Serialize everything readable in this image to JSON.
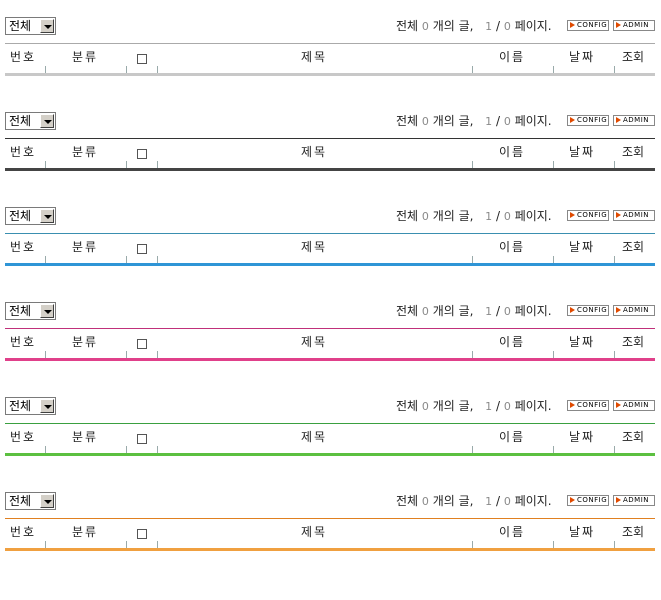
{
  "boards": [
    {
      "filter": "전체",
      "status": {
        "pre": "전체",
        "count": "0",
        "mid": "개의 글,",
        "page": "1",
        "sep": "/",
        "total": "0",
        "suf": "페이지."
      },
      "buttons": {
        "config": "CONFIG",
        "admin": "ADMIN"
      },
      "columns": {
        "num": "번호",
        "category": "분류",
        "title": "제목",
        "name": "이름",
        "date": "날짜",
        "views": "조회"
      },
      "colors": {
        "top": "#aaaaaa",
        "bottom": "#c8c8c8"
      }
    },
    {
      "filter": "전체",
      "status": {
        "pre": "전체",
        "count": "0",
        "mid": "개의 글,",
        "page": "1",
        "sep": "/",
        "total": "0",
        "suf": "페이지."
      },
      "buttons": {
        "config": "CONFIG",
        "admin": "ADMIN"
      },
      "columns": {
        "num": "번호",
        "category": "분류",
        "title": "제목",
        "name": "이름",
        "date": "날짜",
        "views": "조회"
      },
      "colors": {
        "top": "#333333",
        "bottom": "#444444"
      }
    },
    {
      "filter": "전체",
      "status": {
        "pre": "전체",
        "count": "0",
        "mid": "개의 글,",
        "page": "1",
        "sep": "/",
        "total": "0",
        "suf": "페이지."
      },
      "buttons": {
        "config": "CONFIG",
        "admin": "ADMIN"
      },
      "columns": {
        "num": "번호",
        "category": "분류",
        "title": "제목",
        "name": "이름",
        "date": "날짜",
        "views": "조회"
      },
      "colors": {
        "top": "#3a8fb0",
        "bottom": "#2f95d6"
      }
    },
    {
      "filter": "전체",
      "status": {
        "pre": "전체",
        "count": "0",
        "mid": "개의 글,",
        "page": "1",
        "sep": "/",
        "total": "0",
        "suf": "페이지."
      },
      "buttons": {
        "config": "CONFIG",
        "admin": "ADMIN"
      },
      "columns": {
        "num": "번호",
        "category": "분류",
        "title": "제목",
        "name": "이름",
        "date": "날짜",
        "views": "조회"
      },
      "colors": {
        "top": "#c0307a",
        "bottom": "#e0408a"
      }
    },
    {
      "filter": "전체",
      "status": {
        "pre": "전체",
        "count": "0",
        "mid": "개의 글,",
        "page": "1",
        "sep": "/",
        "total": "0",
        "suf": "페이지."
      },
      "buttons": {
        "config": "CONFIG",
        "admin": "ADMIN"
      },
      "columns": {
        "num": "번호",
        "category": "분류",
        "title": "제목",
        "name": "이름",
        "date": "날짜",
        "views": "조회"
      },
      "colors": {
        "top": "#3aa040",
        "bottom": "#5cc040"
      }
    },
    {
      "filter": "전체",
      "status": {
        "pre": "전체",
        "count": "0",
        "mid": "개의 글,",
        "page": "1",
        "sep": "/",
        "total": "0",
        "suf": "페이지."
      },
      "buttons": {
        "config": "CONFIG",
        "admin": "ADMIN"
      },
      "columns": {
        "num": "번호",
        "category": "분류",
        "title": "제목",
        "name": "이름",
        "date": "날짜",
        "views": "조회"
      },
      "colors": {
        "top": "#e08020",
        "bottom": "#f0a040"
      }
    }
  ]
}
